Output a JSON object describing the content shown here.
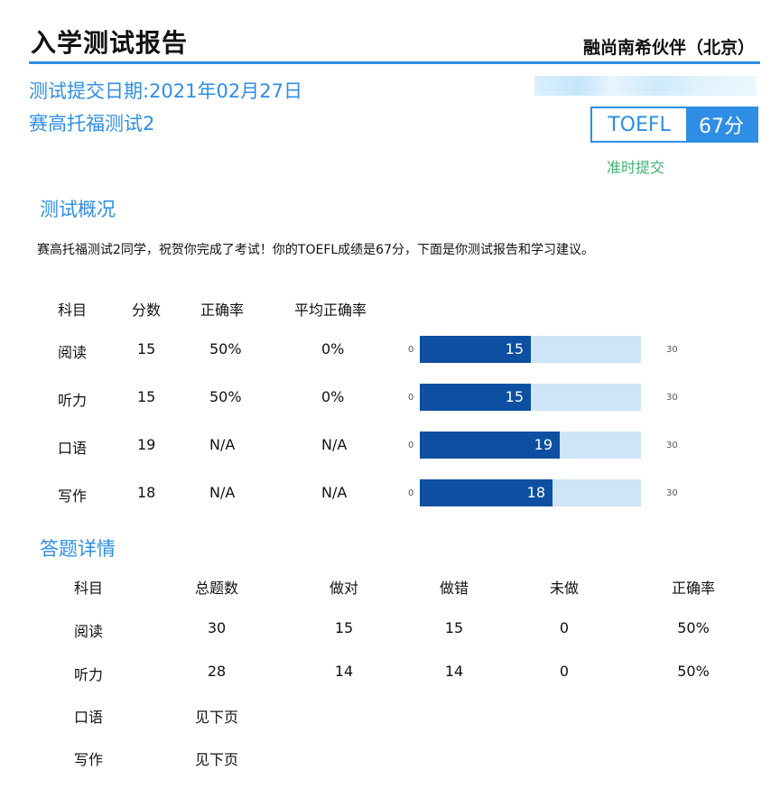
{
  "report": {
    "title": "入学测试报告",
    "org": "融尚南希伙伴（北京）",
    "date_label": "测试提交日期:2021年02月27日",
    "test_name": "赛高托福测试2",
    "exam_type": "TOEFL",
    "score": "67分",
    "status": "准时提交"
  },
  "overview": {
    "heading": "测试概况",
    "summary": "赛高托福测试2同学，祝贺你完成了考试！你的TOEFL成绩是67分，下面是你测试报告和学习建议。",
    "headers": [
      "科目",
      "分数",
      "正确率",
      "平均正确率"
    ],
    "rows": [
      {
        "subject": "阅读",
        "score": "15",
        "accuracy": "50%",
        "avg": "0%"
      },
      {
        "subject": "听力",
        "score": "15",
        "accuracy": "50%",
        "avg": "0%"
      },
      {
        "subject": "口语",
        "score": "19",
        "accuracy": "N/A",
        "avg": "N/A"
      },
      {
        "subject": "写作",
        "score": "18",
        "accuracy": "N/A",
        "avg": "N/A"
      }
    ]
  },
  "chart_data": {
    "type": "bar",
    "orientation": "horizontal",
    "categories": [
      "阅读",
      "听力",
      "口语",
      "写作"
    ],
    "values": [
      15,
      15,
      19,
      18
    ],
    "min_label": "0",
    "max_label": "30",
    "xlim": [
      0,
      30
    ],
    "colors": {
      "fill": "#0d4fa0",
      "track": "#cfe4f5"
    }
  },
  "details": {
    "heading": "答题详情",
    "headers": [
      "科目",
      "总题数",
      "做对",
      "做错",
      "未做",
      "正确率"
    ],
    "rows": [
      [
        "阅读",
        "30",
        "15",
        "15",
        "0",
        "50%"
      ],
      [
        "听力",
        "28",
        "14",
        "14",
        "0",
        "50%"
      ],
      [
        "口语",
        "见下页",
        "",
        "",
        "",
        ""
      ],
      [
        "写作",
        "见下页",
        "",
        "",
        "",
        ""
      ]
    ]
  }
}
